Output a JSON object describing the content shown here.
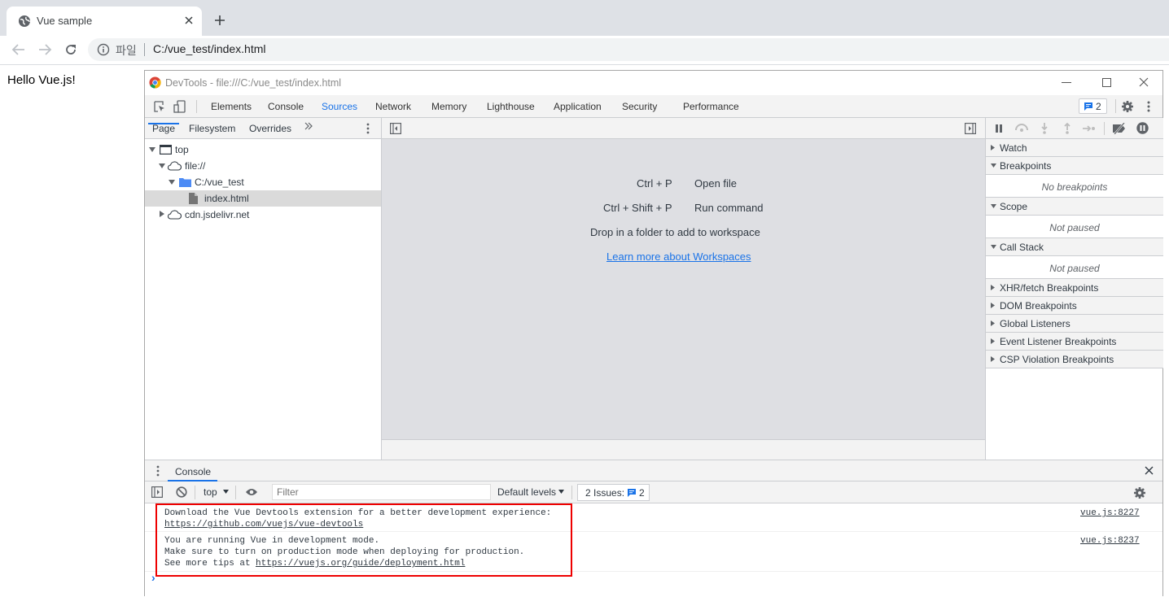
{
  "browser": {
    "tab_title": "Vue sample",
    "address_scheme_label": "파일",
    "address_url": "C:/vue_test/index.html"
  },
  "page": {
    "text": "Hello Vue.js!"
  },
  "devtools": {
    "window_title": "DevTools - file:///C:/vue_test/index.html",
    "main_tabs": [
      "Elements",
      "Console",
      "Sources",
      "Network",
      "Memory",
      "Lighthouse",
      "Application",
      "Security",
      "Performance"
    ],
    "active_tab": "Sources",
    "issues_count": "2",
    "navigator": {
      "tabs": [
        "Page",
        "Filesystem",
        "Overrides"
      ],
      "tree": {
        "top": "top",
        "file": "file://",
        "folder": "C:/vue_test",
        "index": "index.html",
        "cdn": "cdn.jsdelivr.net"
      }
    },
    "editor": {
      "shortcut1_key": "Ctrl + P",
      "shortcut1_label": "Open file",
      "shortcut2_key": "Ctrl + Shift + P",
      "shortcut2_label": "Run command",
      "drop_text": "Drop in a folder to add to workspace",
      "learn_link": "Learn more about Workspaces"
    },
    "debugger": {
      "watch": "Watch",
      "breakpoints": "Breakpoints",
      "no_breakpoints": "No breakpoints",
      "scope": "Scope",
      "scope_status": "Not paused",
      "call_stack": "Call Stack",
      "call_stack_status": "Not paused",
      "xhr": "XHR/fetch Breakpoints",
      "dom": "DOM Breakpoints",
      "global": "Global Listeners",
      "event": "Event Listener Breakpoints",
      "csp": "CSP Violation Breakpoints"
    },
    "console": {
      "tab_label": "Console",
      "context": "top",
      "filter_placeholder": "Filter",
      "levels": "Default levels",
      "issues_label": "2 Issues:",
      "issues_count": "2",
      "messages": [
        {
          "line1": "Download the Vue Devtools extension for a better development experience:",
          "link": "https://github.com/vuejs/vue-devtools",
          "source": "vue.js:8227"
        },
        {
          "line1": "You are running Vue in development mode.",
          "line2": "Make sure to turn on production mode when deploying for production.",
          "line3_prefix": "See more tips at ",
          "link": "https://vuejs.org/guide/deployment.html",
          "source": "vue.js:8237"
        }
      ],
      "prompt": "›"
    }
  },
  "colors": {
    "accent": "#1a73e8",
    "highlight_box": "#ee0000"
  }
}
